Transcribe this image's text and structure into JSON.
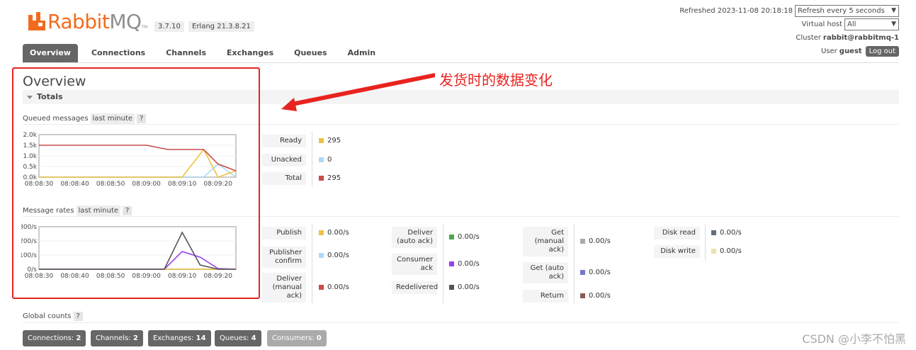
{
  "header": {
    "logo_rabbit": "Rabbit",
    "logo_mq": "MQ",
    "logo_tm": "TM",
    "version": "3.7.10",
    "erlang": "Erlang 21.3.8.21",
    "refreshed_prefix": "Refreshed",
    "refreshed_time": "2023-11-08 20:18:18",
    "refresh_select": "Refresh every 5 seconds",
    "vhost_label": "Virtual host",
    "vhost_select": "All",
    "cluster_label": "Cluster",
    "cluster_value": "rabbit@rabbitmq-1",
    "user_label": "User",
    "user_value": "guest",
    "logout": "Log out"
  },
  "nav": {
    "tabs": [
      "Overview",
      "Connections",
      "Channels",
      "Exchanges",
      "Queues",
      "Admin"
    ],
    "active": "Overview"
  },
  "page": {
    "title": "Overview",
    "totals": "Totals"
  },
  "queued": {
    "title": "Queued messages",
    "range": "last minute",
    "help": "?",
    "labels": [
      "Ready",
      "Unacked",
      "Total"
    ],
    "values": [
      "295",
      "0",
      "295"
    ]
  },
  "rates": {
    "title": "Message rates",
    "range": "last minute",
    "help": "?",
    "col1": {
      "labels": [
        "Publish",
        "Publisher confirm",
        "Deliver (manual ack)"
      ],
      "values": [
        "0.00/s",
        "0.00/s",
        "0.00/s"
      ]
    },
    "col2": {
      "labels": [
        "Deliver (auto ack)",
        "Consumer ack",
        "Redelivered"
      ],
      "values": [
        "0.00/s",
        "0.00/s",
        "0.00/s"
      ]
    },
    "col3": {
      "labels": [
        "Get (manual ack)",
        "Get (auto ack)",
        "Return"
      ],
      "values": [
        "0.00/s",
        "0.00/s",
        "0.00/s"
      ]
    },
    "col4": {
      "labels": [
        "Disk read",
        "Disk write"
      ],
      "values": [
        "0.00/s",
        "0.00/s"
      ]
    }
  },
  "global": {
    "title": "Global counts",
    "help": "?",
    "counts": [
      {
        "label": "Connections:",
        "value": "2"
      },
      {
        "label": "Channels:",
        "value": "2"
      },
      {
        "label": "Exchanges:",
        "value": "14"
      },
      {
        "label": "Queues:",
        "value": "4"
      },
      {
        "label": "Consumers:",
        "value": "0"
      }
    ]
  },
  "annotation": {
    "text": "发货时的数据变化",
    "watermark": "CSDN @小李不怕黑"
  },
  "colors": {
    "ready": "#edc240",
    "unacked": "#afd8f8",
    "total": "#cb4b4b",
    "publish": "#edc240",
    "publisher_confirm": "#afd8f8",
    "deliver_manual": "#cb4b4b",
    "deliver_auto": "#4da74d",
    "consumer_ack": "#9440ed",
    "redelivered": "#555555",
    "get_manual": "#aaaaaa",
    "get_auto": "#7777cc",
    "return": "#8b5a5a",
    "disk_read": "#5f7080",
    "disk_write": "#ede1a8",
    "annotation": "#e8231f"
  },
  "chart_data": [
    {
      "type": "line",
      "title": "Queued messages",
      "x": [
        "08:08:30",
        "08:08:40",
        "08:08:50",
        "08:09:00",
        "08:09:10",
        "08:09:20"
      ],
      "y_ticks": [
        "2.0k",
        "1.5k",
        "1.0k",
        "0.5k",
        "0.0k"
      ],
      "ylim": [
        0,
        2000
      ],
      "x_points": [
        0,
        10,
        20,
        30,
        36,
        40,
        46,
        50,
        55
      ],
      "series": [
        {
          "name": "Total",
          "color": "#cb4b4b",
          "values": [
            1500,
            1500,
            1500,
            1500,
            1300,
            1300,
            1300,
            620,
            295
          ]
        },
        {
          "name": "Ready",
          "color": "#edc240",
          "values": [
            0,
            0,
            0,
            0,
            0,
            0,
            1300,
            0,
            295
          ]
        },
        {
          "name": "Unacked",
          "color": "#afd8f8",
          "values": [
            0,
            0,
            0,
            0,
            0,
            0,
            0,
            620,
            0
          ]
        }
      ]
    },
    {
      "type": "line",
      "title": "Message rates",
      "x": [
        "08:08:30",
        "08:08:40",
        "08:08:50",
        "08:09:00",
        "08:09:10",
        "08:09:20"
      ],
      "y_ticks": [
        "300/s",
        "200/s",
        "100/s",
        "0/s"
      ],
      "ylim": [
        0,
        300
      ],
      "x_points": [
        0,
        10,
        20,
        30,
        35,
        40,
        45,
        50,
        55
      ],
      "series": [
        {
          "name": "Redelivered",
          "color": "#555555",
          "values": [
            0,
            0,
            0,
            0,
            0,
            260,
            30,
            0,
            0
          ]
        },
        {
          "name": "Consumer ack",
          "color": "#9440ed",
          "values": [
            0,
            0,
            0,
            0,
            0,
            125,
            85,
            5,
            0
          ]
        },
        {
          "name": "Publish",
          "color": "#edc240",
          "values": [
            0,
            0,
            0,
            0,
            0,
            0,
            0,
            0,
            0
          ]
        }
      ]
    }
  ]
}
